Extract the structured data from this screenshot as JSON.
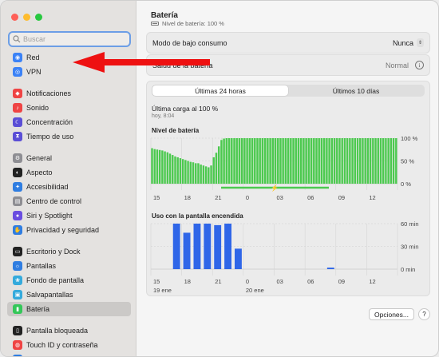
{
  "sidebar": {
    "search_placeholder": "Buscar",
    "groups": [
      [
        {
          "label": "Red",
          "icon": "network-icon",
          "color": "#3b82f6"
        },
        {
          "label": "VPN",
          "icon": "vpn-icon",
          "color": "#3b82f6"
        }
      ],
      [
        {
          "label": "Notificaciones",
          "icon": "bell-icon",
          "color": "#ef4444"
        },
        {
          "label": "Sonido",
          "icon": "speaker-icon",
          "color": "#ef4444"
        },
        {
          "label": "Concentración",
          "icon": "moon-icon",
          "color": "#5b4fd6"
        },
        {
          "label": "Tiempo de uso",
          "icon": "hourglass-icon",
          "color": "#5b4fd6"
        }
      ],
      [
        {
          "label": "General",
          "icon": "gear-icon",
          "color": "#8e8e93"
        },
        {
          "label": "Aspecto",
          "icon": "appearance-icon",
          "color": "#222222"
        },
        {
          "label": "Accesibilidad",
          "icon": "accessibility-icon",
          "color": "#2f7de1"
        },
        {
          "label": "Centro de control",
          "icon": "control-center-icon",
          "color": "#8e8e93"
        },
        {
          "label": "Siri y Spotlight",
          "icon": "siri-icon",
          "color": "#6a4de0"
        },
        {
          "label": "Privacidad y seguridad",
          "icon": "hand-icon",
          "color": "#2f7de1"
        }
      ],
      [
        {
          "label": "Escritorio y Dock",
          "icon": "dock-icon",
          "color": "#222222"
        },
        {
          "label": "Pantallas",
          "icon": "display-icon",
          "color": "#2f7de1"
        },
        {
          "label": "Fondo de pantalla",
          "icon": "wallpaper-icon",
          "color": "#34aadc"
        },
        {
          "label": "Salvapantallas",
          "icon": "screensaver-icon",
          "color": "#34aadc"
        },
        {
          "label": "Batería",
          "icon": "battery-icon",
          "color": "#34c759",
          "active": true
        }
      ],
      [
        {
          "label": "Pantalla bloqueada",
          "icon": "lock-screen-icon",
          "color": "#222222"
        },
        {
          "label": "Touch ID y contraseña",
          "icon": "fingerprint-icon",
          "color": "#ef4444"
        },
        {
          "label": "Usuarios y grupos",
          "icon": "users-icon",
          "color": "#2f7de1"
        }
      ]
    ]
  },
  "header": {
    "title": "Batería",
    "subtitle": "Nivel de batería: 100 %"
  },
  "settings": {
    "low_power_label": "Modo de bajo consumo",
    "low_power_value": "Nunca",
    "health_label": "Salud de la batería",
    "health_value": "Normal"
  },
  "tabs": {
    "tab1": "Últimas 24 horas",
    "tab2": "Últimos 10 días",
    "active": "tab1"
  },
  "last_charge": {
    "label": "Última carga al 100 %",
    "time": "hoy, 8:04"
  },
  "chart_data": [
    {
      "type": "bar",
      "title": "Nivel de batería",
      "x_ticks": [
        "15",
        "18",
        "21",
        "0",
        "03",
        "06",
        "09",
        "12"
      ],
      "y_ticks": [
        "100 %",
        "50 %",
        "0 %"
      ],
      "ylim": [
        0,
        100
      ],
      "values": [
        78,
        76,
        75,
        74,
        73,
        71,
        69,
        66,
        63,
        60,
        58,
        56,
        54,
        52,
        50,
        48,
        47,
        45,
        45,
        42,
        40,
        38,
        36,
        40,
        58,
        68,
        82,
        96,
        99,
        100,
        100,
        100,
        100,
        100,
        100,
        100,
        100,
        100,
        100,
        100,
        100,
        100,
        100,
        100,
        100,
        100,
        100,
        100,
        100,
        100,
        100,
        100,
        100,
        100,
        100,
        100,
        100,
        100,
        100,
        100,
        100,
        100,
        100,
        100,
        100,
        100,
        100,
        100,
        100,
        100,
        100,
        100,
        100,
        100,
        100,
        100,
        100,
        100,
        100,
        100,
        100,
        100,
        100,
        100,
        100,
        100,
        100,
        100,
        100,
        100,
        100,
        100,
        100,
        100,
        100,
        100
      ],
      "color": "#4cc94f"
    },
    {
      "type": "bar",
      "title": "Uso con la pantalla encendida",
      "x_ticks": [
        "15",
        "18",
        "21",
        "0",
        "03",
        "06",
        "09",
        "12"
      ],
      "x_subticks": [
        "19 ene",
        "20 ene"
      ],
      "y_ticks": [
        "60 min",
        "30 min",
        "0 min"
      ],
      "ylim": [
        0,
        60
      ],
      "categories": [
        "15",
        "16",
        "17",
        "18",
        "19",
        "20",
        "21",
        "22",
        "23",
        "0",
        "1",
        "2",
        "3",
        "4",
        "5",
        "6",
        "7",
        "8",
        "9",
        "10",
        "11",
        "12",
        "13",
        "14"
      ],
      "values": [
        0,
        0,
        60,
        48,
        60,
        60,
        58,
        60,
        27,
        0,
        0,
        0,
        0,
        0,
        0,
        0,
        0,
        2,
        0,
        0,
        0,
        0,
        0,
        0
      ],
      "color": "#2f66e8"
    }
  ],
  "footer": {
    "options_label": "Opciones...",
    "help_label": "?"
  }
}
